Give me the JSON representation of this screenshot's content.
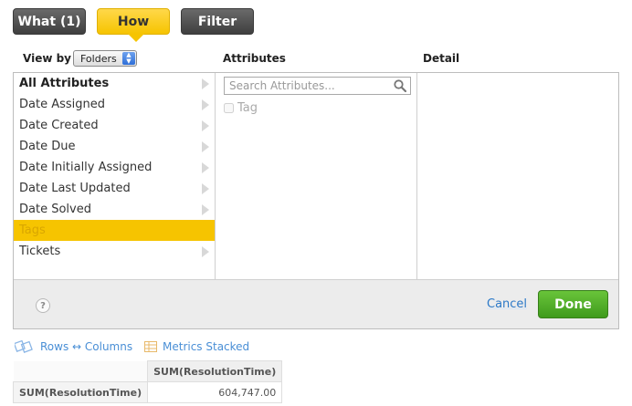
{
  "tabs": {
    "what": "What (1)",
    "how": "How",
    "filter": "Filter"
  },
  "headers": {
    "view_by": "View by",
    "view_by_value": "Folders",
    "attributes": "Attributes",
    "detail": "Detail"
  },
  "folders": [
    "All Attributes",
    "Date Assigned",
    "Date Created",
    "Date Due",
    "Date Initially Assigned",
    "Date Last Updated",
    "Date Solved",
    "Tags",
    "Tickets"
  ],
  "selected_folder": "Tags",
  "search": {
    "placeholder": "Search Attributes..."
  },
  "attributes_list": [
    {
      "label": "Tag",
      "checked": false
    }
  ],
  "footer": {
    "help": "?",
    "cancel": "Cancel",
    "done": "Done"
  },
  "toolbar": {
    "swap": "Rows ↔ Columns",
    "metrics": "Metrics Stacked"
  },
  "result_table": {
    "column_header": "SUM(ResolutionTime)",
    "row_header": "SUM(ResolutionTime)",
    "value": "604,747.00"
  },
  "colors": {
    "accent": "#f6c400",
    "done_green": "#4fae26",
    "link_blue": "#2a78c8"
  }
}
